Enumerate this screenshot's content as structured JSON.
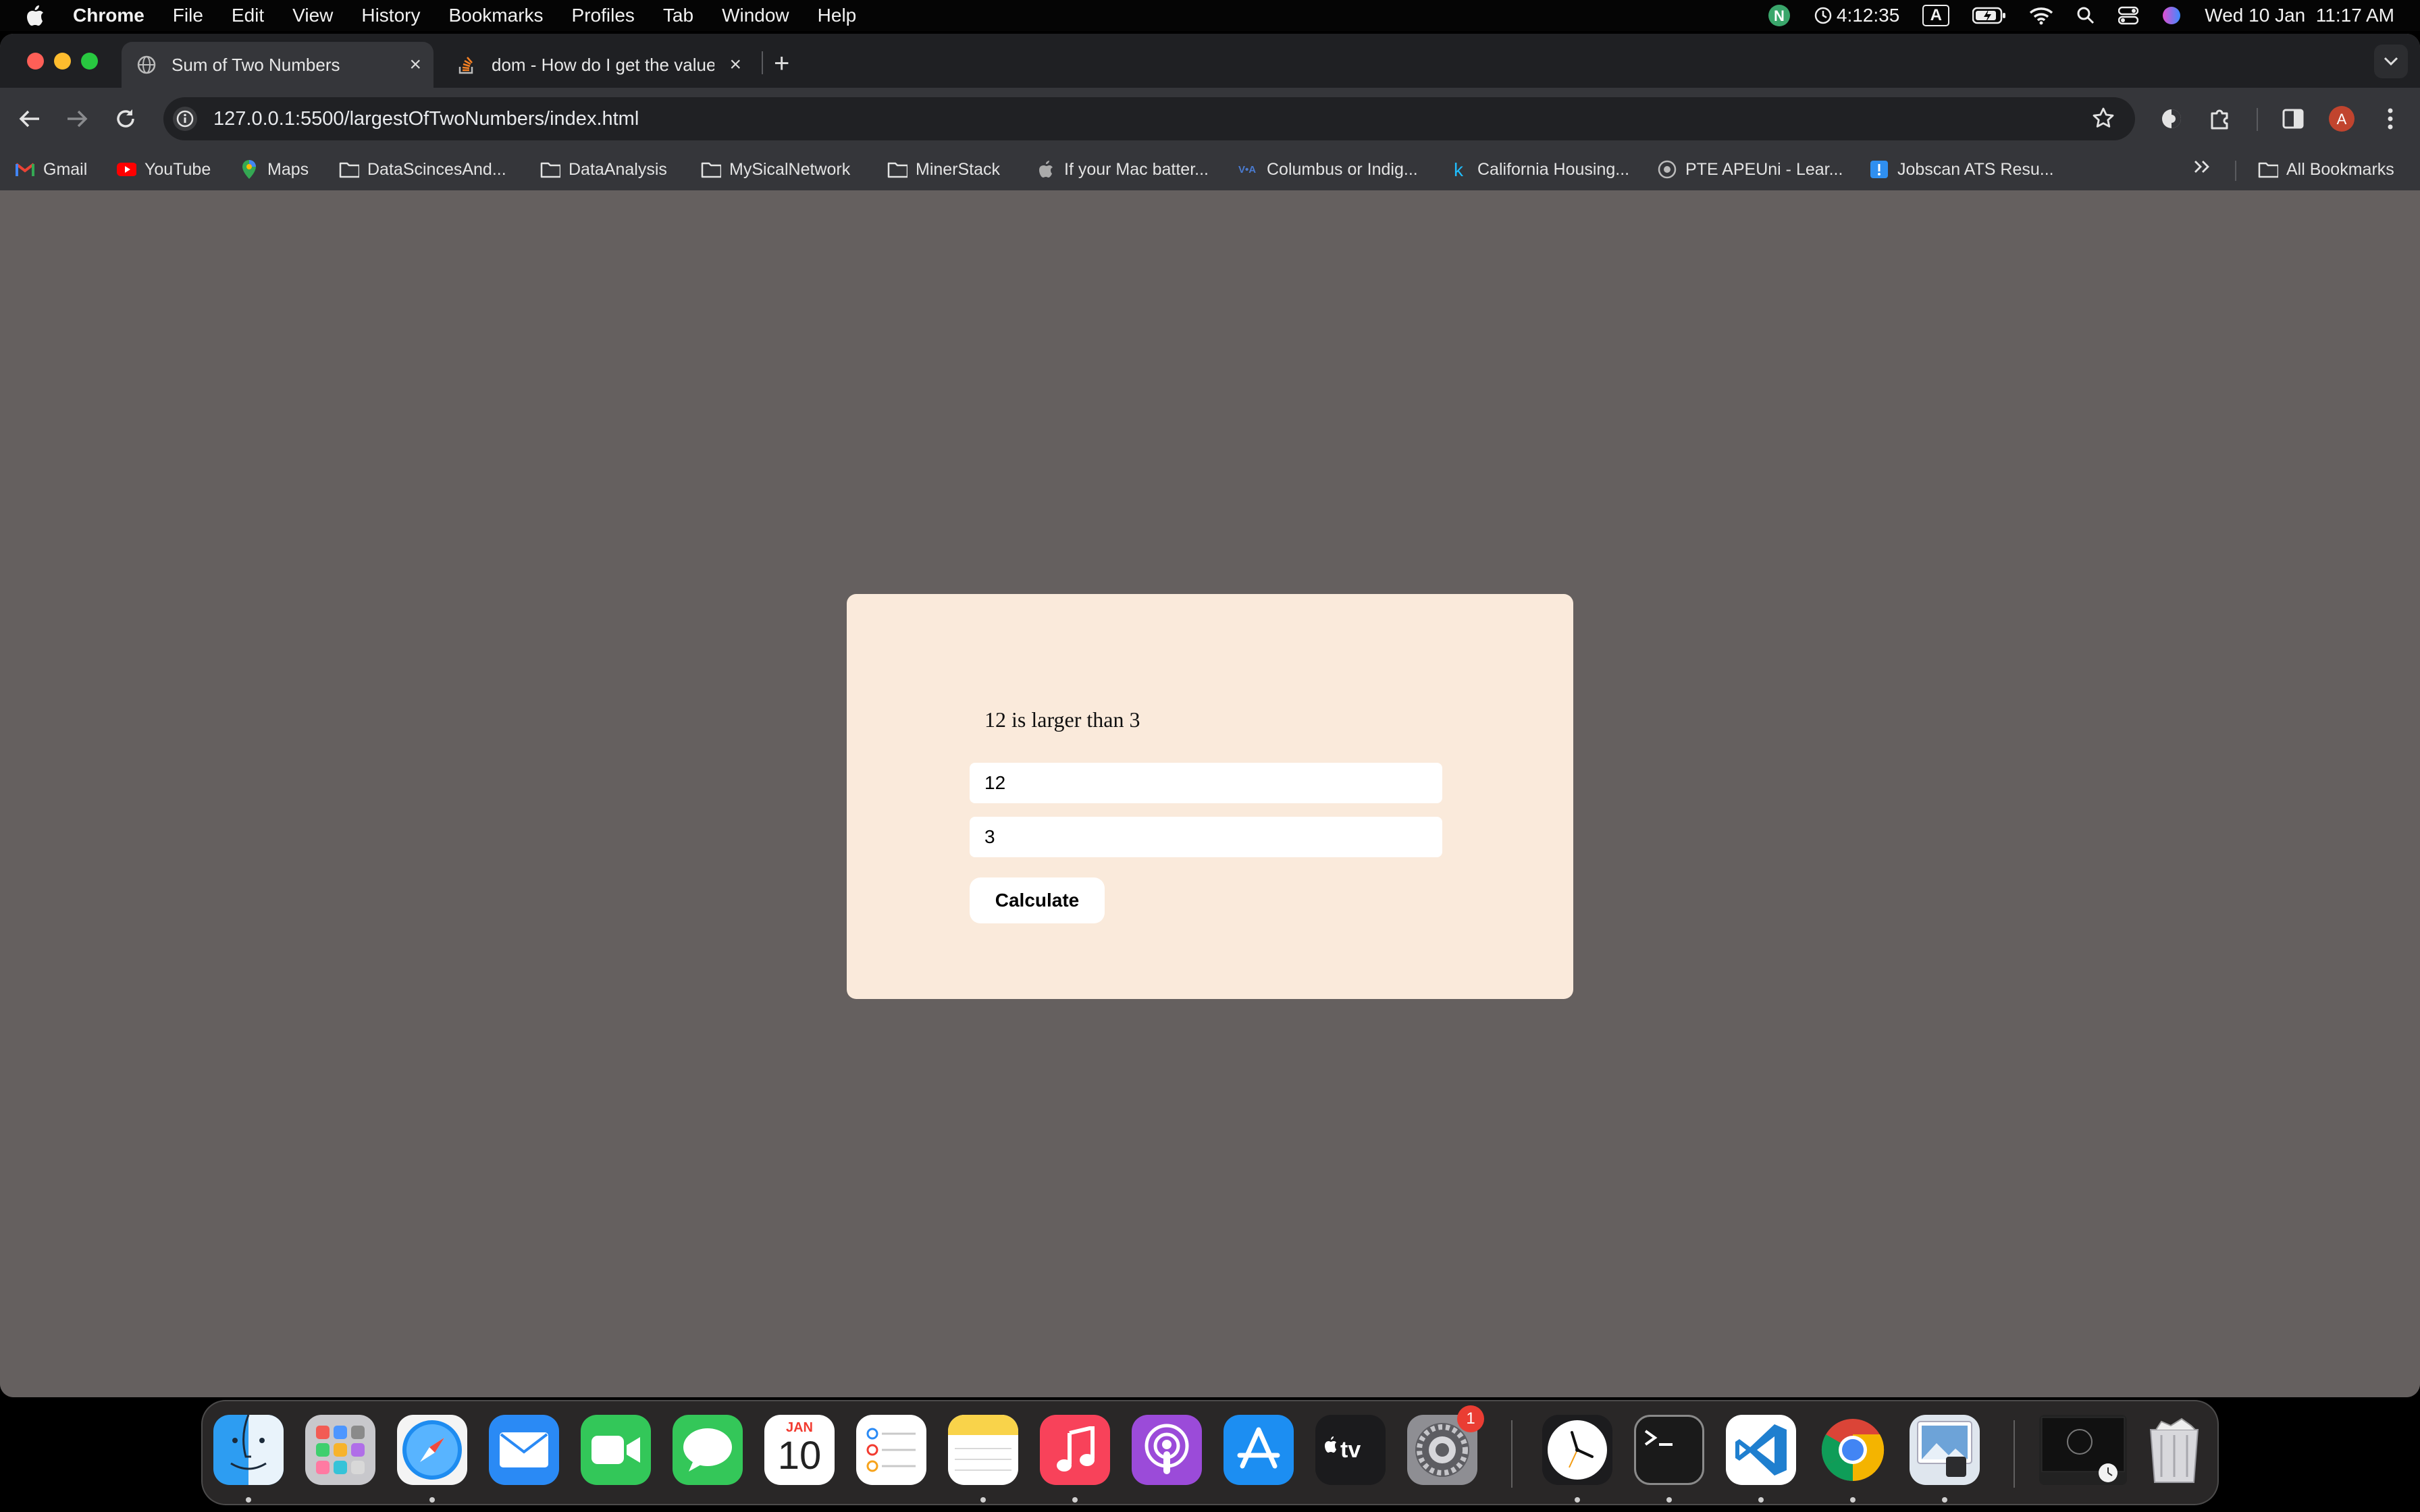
{
  "menubar": {
    "app_name": "Chrome",
    "items": [
      "File",
      "Edit",
      "View",
      "History",
      "Bookmarks",
      "Profiles",
      "Tab",
      "Window",
      "Help"
    ],
    "timer": "4:12:35",
    "input_source": "A",
    "datetime": "Wed 10 Jan  11:17 AM",
    "status_icons": [
      "n-app-icon",
      "timer-icon",
      "input-source-icon",
      "battery-icon",
      "wifi-icon",
      "spotlight-icon",
      "control-center-icon",
      "siri-icon"
    ]
  },
  "browser": {
    "tabs": [
      {
        "title": "Sum of Two Numbers",
        "icon": "globe-icon",
        "active": true
      },
      {
        "title": "dom - How do I get the value",
        "icon": "stackoverflow-icon",
        "active": false
      }
    ],
    "url": "127.0.0.1:5500/largestOfTwoNumbers/index.html",
    "profile_initial": "A",
    "bookmarks": [
      {
        "label": "Gmail",
        "icon": "gmail-icon"
      },
      {
        "label": "YouTube",
        "icon": "youtube-icon"
      },
      {
        "label": "Maps",
        "icon": "maps-icon"
      },
      {
        "label": "DataScincesAnd...",
        "icon": "folder-icon"
      },
      {
        "label": "DataAnalysis",
        "icon": "folder-icon"
      },
      {
        "label": "MySicalNetwork",
        "icon": "folder-icon"
      },
      {
        "label": "MinerStack",
        "icon": "folder-icon"
      },
      {
        "label": "If your Mac batter...",
        "icon": "apple-icon"
      },
      {
        "label": "Columbus or Indig...",
        "icon": "site-icon"
      },
      {
        "label": "California Housing...",
        "icon": "kaggle-icon"
      },
      {
        "label": "PTE APEUni - Lear...",
        "icon": "site-icon"
      },
      {
        "label": "Jobscan ATS Resu...",
        "icon": "jobscan-icon"
      }
    ],
    "all_bookmarks": "All Bookmarks"
  },
  "page": {
    "result": "12 is larger than 3",
    "input1_value": "12",
    "input2_value": "3",
    "button_label": "Calculate",
    "card_color": "#faeadb",
    "background_color": "#65605f"
  },
  "dock": {
    "apps": [
      "Finder",
      "Launchpad",
      "Safari",
      "Mail",
      "FaceTime",
      "Messages",
      "Calendar",
      "Reminders",
      "Notes",
      "Music",
      "Podcasts",
      "App Store",
      "TV",
      "System Settings",
      "Clock",
      "Terminal",
      "Visual Studio Code",
      "Google Chrome",
      "Preview",
      "Screen Saver",
      "Trash"
    ],
    "calendar_month": "JAN",
    "calendar_day": "10",
    "settings_badge": "1"
  }
}
